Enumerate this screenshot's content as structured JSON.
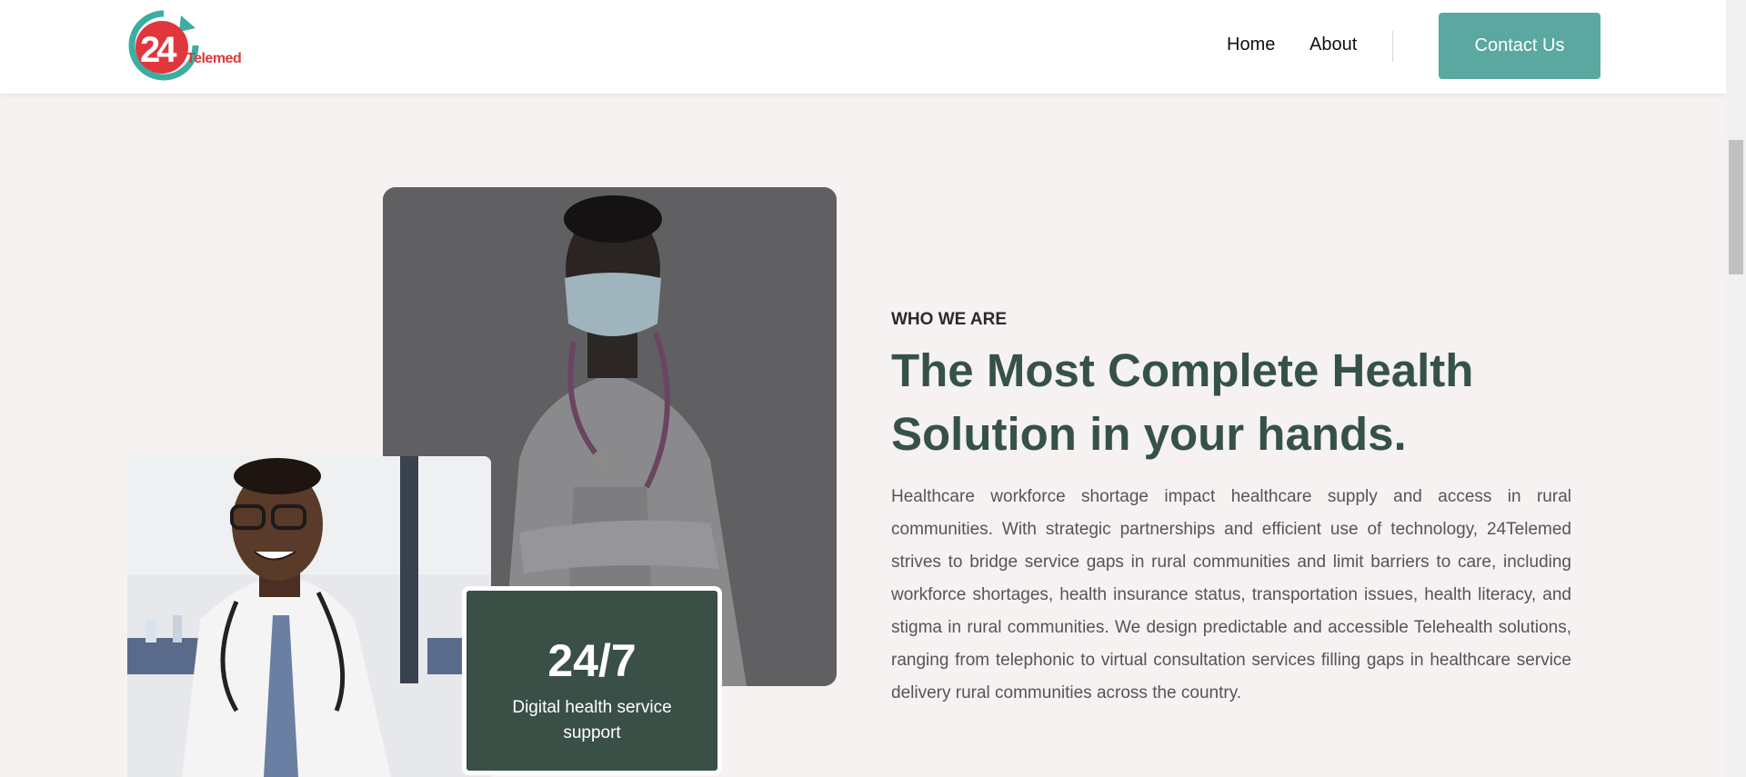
{
  "brand": {
    "logo_number": "24",
    "logo_text": "Telemed",
    "accent_red": "#e2363d",
    "accent_teal": "#3aaea1"
  },
  "nav": {
    "home": "Home",
    "about": "About",
    "contact": "Contact Us"
  },
  "colors": {
    "button": "#5aa8a0",
    "heading": "#365248",
    "card": "#3a5047",
    "background": "#f5f2f1"
  },
  "about": {
    "eyebrow": "WHO WE ARE",
    "title": "The Most Complete Health Solution in your hands.",
    "body": "Healthcare workforce shortage impact healthcare supply and access in rural communities. With strategic partnerships and efficient use of technology, 24Telemed strives to bridge service gaps in rural communities and limit barriers to care, including workforce shortages, health insurance status, transportation issues, health literacy, and stigma in rural communities. We design predictable and accessible Telehealth solutions, ranging from telephonic to virtual consultation services filling gaps in healthcare service delivery rural communities across the country."
  },
  "stat": {
    "value": "24/7",
    "label": "Digital health service support"
  },
  "images": {
    "back": "doctor-with-mask-photo",
    "front": "smiling-doctor-photo"
  }
}
